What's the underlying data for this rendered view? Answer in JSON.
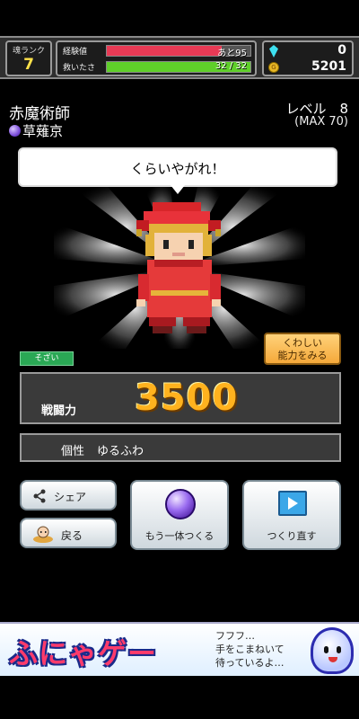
{
  "status": {
    "rank_label": "魂ランク",
    "rank_value": "7",
    "exp_label": "経験値",
    "exp_text": "あと95",
    "exp_fraction": 0.8,
    "save_label": "救いたさ",
    "save_text": "32 / 32",
    "save_fraction": 1.0,
    "gem_count": "0",
    "coin_count": "5201",
    "colors": {
      "exp_bar": "#e83a55",
      "save_bar": "#5fcf2a"
    }
  },
  "character": {
    "name": "赤魔術師",
    "author": "草薙京",
    "level_label": "レベル　8",
    "level_max": "(MAX 70)",
    "speech": "くらいやがれ！",
    "sozai_badge": "そざい",
    "detail_button": [
      "くわしい",
      "能力をみる"
    ],
    "power_label": "戦闘力",
    "power_value": "3500",
    "trait_label": "個性",
    "trait_value": "ゆるふわ"
  },
  "buttons": {
    "share": "シェア",
    "back": "戻る",
    "make_another": "もう一体つくる",
    "remake": "つくり直す"
  },
  "ad": {
    "logo": "ふにゃゲー",
    "line1": "フフフ…",
    "line2": "手をこまねいて",
    "line3": "待っているよ…"
  }
}
